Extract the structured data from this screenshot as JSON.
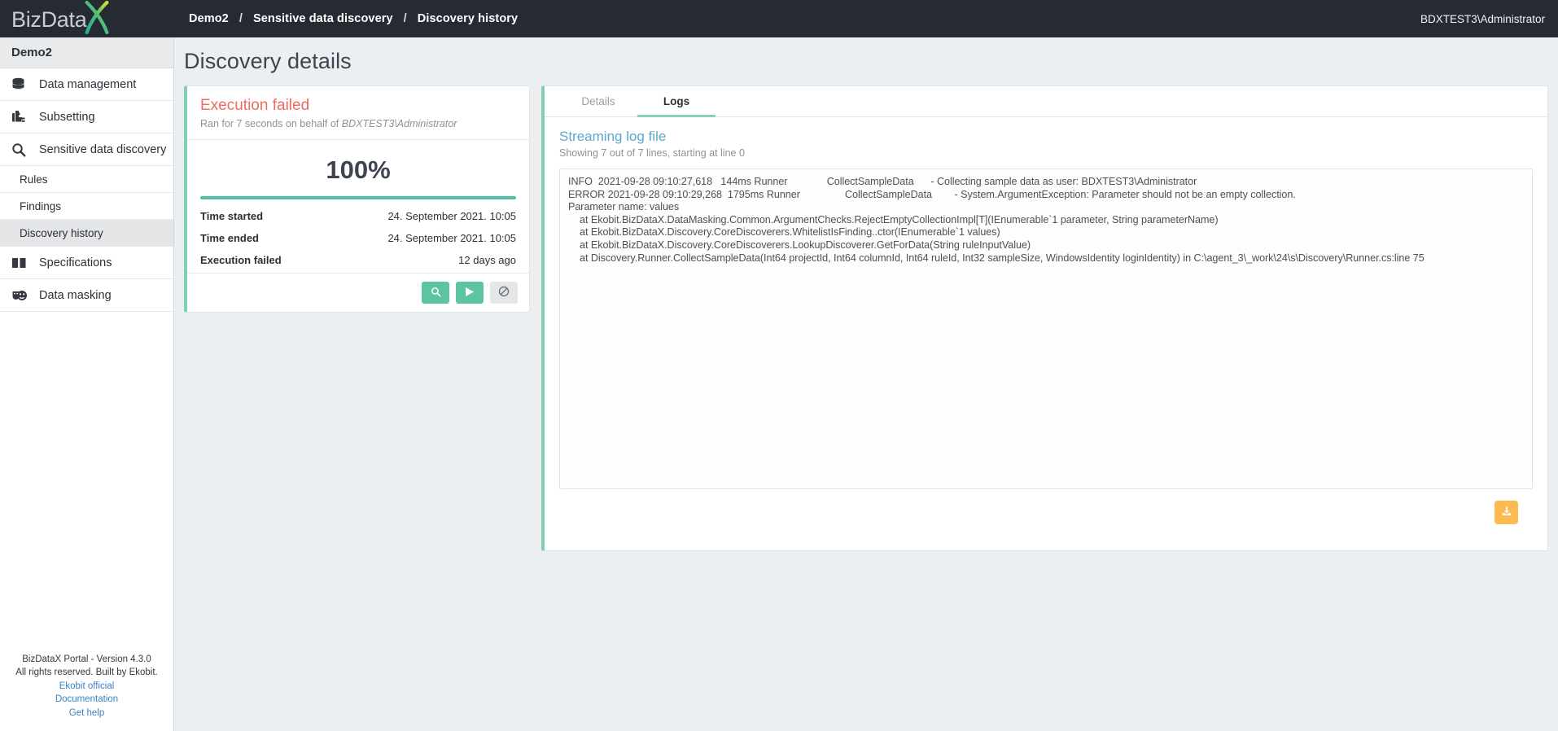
{
  "brand": {
    "logo_text": "BizData",
    "logo_mark": "X",
    "accent_teal": "#1fb89c",
    "accent_lime": "#c5d92e"
  },
  "topbar": {
    "breadcrumb": [
      "Demo2",
      "Sensitive data discovery",
      "Discovery history"
    ],
    "separator": "/",
    "user": "BDXTEST3\\Administrator"
  },
  "sidebar": {
    "project": "Demo2",
    "items": [
      {
        "label": "Data management",
        "icon": "database-icon"
      },
      {
        "label": "Subsetting",
        "icon": "puzzle-icon"
      },
      {
        "label": "Sensitive data discovery",
        "icon": "magnifier-icon"
      }
    ],
    "sub_items": [
      {
        "label": "Rules",
        "active": false
      },
      {
        "label": "Findings",
        "active": false
      },
      {
        "label": "Discovery history",
        "active": true
      }
    ],
    "items_after": [
      {
        "label": "Specifications",
        "icon": "book-icon"
      },
      {
        "label": "Data masking",
        "icon": "masks-icon"
      }
    ],
    "footer": {
      "version": "BizDataX Portal - Version 4.3.0",
      "rights": "All rights reserved. Built by Ekobit.",
      "links": [
        "Ekobit official",
        "Documentation",
        "Get help"
      ]
    }
  },
  "page": {
    "title": "Discovery details"
  },
  "execution": {
    "status": "Execution failed",
    "subtitle_prefix": "Ran for 7 seconds on behalf of ",
    "subtitle_user": "BDXTEST3\\Administrator",
    "percent_label": "100%",
    "percent_value": 100,
    "rows": [
      {
        "key": "Time started",
        "value": "24. September 2021. 10:05"
      },
      {
        "key": "Time ended",
        "value": "24. September 2021. 10:05"
      },
      {
        "key": "Execution failed",
        "value": "12 days ago"
      }
    ],
    "actions": [
      {
        "name": "inspect-button",
        "icon": "magnifier-icon",
        "style": "green"
      },
      {
        "name": "run-button",
        "icon": "play-icon",
        "style": "green"
      },
      {
        "name": "cancel-button",
        "icon": "ban-icon",
        "style": "grey"
      }
    ]
  },
  "logs": {
    "tabs": [
      {
        "label": "Details",
        "active": false
      },
      {
        "label": "Logs",
        "active": true
      }
    ],
    "title": "Streaming log file",
    "subtitle": "Showing 7 out of 7 lines, starting at line 0",
    "lines": [
      {
        "text": "INFO  2021-09-28 09:10:27,618   144ms Runner              CollectSampleData      - Collecting sample data as user: BDXTEST3\\Administrator",
        "indent": false
      },
      {
        "text": "ERROR 2021-09-28 09:10:29,268  1795ms Runner                CollectSampleData        - System.ArgumentException: Parameter should not be an empty collection.",
        "indent": false
      },
      {
        "text": "Parameter name: values",
        "indent": false
      },
      {
        "text": "at Ekobit.BizDataX.DataMasking.Common.ArgumentChecks.RejectEmptyCollectionImpl[T](IEnumerable`1 parameter, String parameterName)",
        "indent": true
      },
      {
        "text": "at Ekobit.BizDataX.Discovery.CoreDiscoverers.WhitelistIsFinding..ctor(IEnumerable`1 values)",
        "indent": true
      },
      {
        "text": "at Ekobit.BizDataX.Discovery.CoreDiscoverers.LookupDiscoverer.GetForData(String ruleInputValue)",
        "indent": true
      },
      {
        "text": "at Discovery.Runner.CollectSampleData(Int64 projectId, Int64 columnId, Int64 ruleId, Int32 sampleSize, WindowsIdentity loginIdentity) in C:\\agent_3\\_work\\24\\s\\Discovery\\Runner.cs:line 75",
        "indent": true
      }
    ],
    "download": {
      "name": "download-logs-button",
      "icon": "download-icon"
    }
  }
}
